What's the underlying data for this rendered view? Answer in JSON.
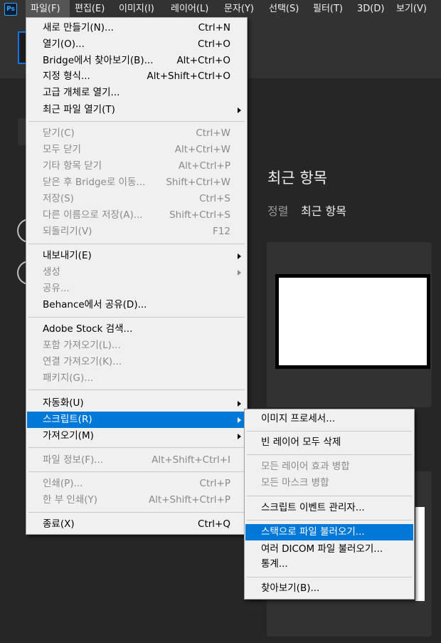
{
  "app": {
    "logo_text": "Ps"
  },
  "menubar": {
    "items": [
      {
        "label": "파일(F)"
      },
      {
        "label": "편집(E)"
      },
      {
        "label": "이미지(I)"
      },
      {
        "label": "레이어(L)"
      },
      {
        "label": "문자(Y)"
      },
      {
        "label": "선택(S)"
      },
      {
        "label": "필터(T)"
      },
      {
        "label": "3D(D)"
      },
      {
        "label": "보기(V)"
      }
    ]
  },
  "home": {
    "recent_title": "최근 항목",
    "sort_label": "정렬",
    "sort_value": "최근 항목"
  },
  "file_menu": {
    "items": [
      {
        "label": "새로 만들기(N)...",
        "shortcut": "Ctrl+N"
      },
      {
        "label": "열기(O)...",
        "shortcut": "Ctrl+O"
      },
      {
        "label": "Bridge에서 찾아보기(B)...",
        "shortcut": "Alt+Ctrl+O"
      },
      {
        "label": "지정 형식...",
        "shortcut": "Alt+Shift+Ctrl+O"
      },
      {
        "label": "고급 개체로 열기...",
        "shortcut": ""
      },
      {
        "label": "최근 파일 열기(T)",
        "shortcut": ""
      },
      {
        "label": "닫기(C)",
        "shortcut": "Ctrl+W"
      },
      {
        "label": "모두 닫기",
        "shortcut": "Alt+Ctrl+W"
      },
      {
        "label": "기타 항목 닫기",
        "shortcut": "Alt+Ctrl+P"
      },
      {
        "label": "닫은 후 Bridge로 이동...",
        "shortcut": "Shift+Ctrl+W"
      },
      {
        "label": "저장(S)",
        "shortcut": "Ctrl+S"
      },
      {
        "label": "다른 이름으로 저장(A)...",
        "shortcut": "Shift+Ctrl+S"
      },
      {
        "label": "되돌리기(V)",
        "shortcut": "F12"
      },
      {
        "label": "내보내기(E)",
        "shortcut": ""
      },
      {
        "label": "생성",
        "shortcut": ""
      },
      {
        "label": "공유...",
        "shortcut": ""
      },
      {
        "label": "Behance에서 공유(D)...",
        "shortcut": ""
      },
      {
        "label": "Adobe Stock 검색...",
        "shortcut": ""
      },
      {
        "label": "포함 가져오기(L)...",
        "shortcut": ""
      },
      {
        "label": "연결 가져오기(K)...",
        "shortcut": ""
      },
      {
        "label": "패키지(G)...",
        "shortcut": ""
      },
      {
        "label": "자동화(U)",
        "shortcut": ""
      },
      {
        "label": "스크립트(R)",
        "shortcut": ""
      },
      {
        "label": "가져오기(M)",
        "shortcut": ""
      },
      {
        "label": "파일 정보(F)...",
        "shortcut": "Alt+Shift+Ctrl+I"
      },
      {
        "label": "인쇄(P)...",
        "shortcut": "Ctrl+P"
      },
      {
        "label": "한 부 인쇄(Y)",
        "shortcut": "Alt+Shift+Ctrl+P"
      },
      {
        "label": "종료(X)",
        "shortcut": "Ctrl+Q"
      }
    ]
  },
  "scripts_submenu": {
    "items": [
      {
        "label": "이미지 프로세서..."
      },
      {
        "label": "빈 레이어 모두 삭제"
      },
      {
        "label": "모든 레이어 효과 병합"
      },
      {
        "label": "모든 마스크 병합"
      },
      {
        "label": "스크립트 이벤트 관리자..."
      },
      {
        "label": "스택으로 파일 불러오기..."
      },
      {
        "label": "여러 DICOM 파일 불러오기..."
      },
      {
        "label": "통계..."
      },
      {
        "label": "찾아보기(B)..."
      }
    ]
  },
  "colors": {
    "highlight": "#0078d7",
    "app_bg": "#262626",
    "accent": "#31a8ff"
  }
}
